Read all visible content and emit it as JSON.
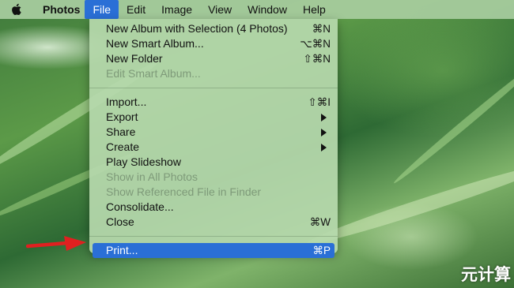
{
  "menubar": {
    "app_name": "Photos",
    "items": [
      "File",
      "Edit",
      "Image",
      "View",
      "Window",
      "Help"
    ],
    "active_index": 0
  },
  "file_menu": {
    "group1": [
      {
        "label": "New Album with Selection (4 Photos)",
        "shortcut": "⌘N",
        "enabled": true
      },
      {
        "label": "New Smart Album...",
        "shortcut": "⌥⌘N",
        "enabled": true
      },
      {
        "label": "New Folder",
        "shortcut": "⇧⌘N",
        "enabled": true
      },
      {
        "label": "Edit Smart Album...",
        "shortcut": "",
        "enabled": false
      }
    ],
    "group2": [
      {
        "label": "Import...",
        "shortcut": "⇧⌘I",
        "enabled": true
      },
      {
        "label": "Export",
        "submenu": true,
        "enabled": true
      },
      {
        "label": "Share",
        "submenu": true,
        "enabled": true
      },
      {
        "label": "Create",
        "submenu": true,
        "enabled": true
      },
      {
        "label": "Play Slideshow",
        "shortcut": "",
        "enabled": true
      },
      {
        "label": "Show in All Photos",
        "shortcut": "",
        "enabled": false
      },
      {
        "label": "Show Referenced File in Finder",
        "shortcut": "",
        "enabled": false
      },
      {
        "label": "Consolidate...",
        "shortcut": "",
        "enabled": true
      },
      {
        "label": "Close",
        "shortcut": "⌘W",
        "enabled": true
      }
    ],
    "group3": [
      {
        "label": "Print...",
        "shortcut": "⌘P",
        "enabled": true,
        "highlighted": true
      }
    ]
  },
  "colors": {
    "highlight": "#2a6fd6",
    "pointer_arrow": "#e02020",
    "menu_bg": "#b6d8ac"
  },
  "watermark": "元计算"
}
